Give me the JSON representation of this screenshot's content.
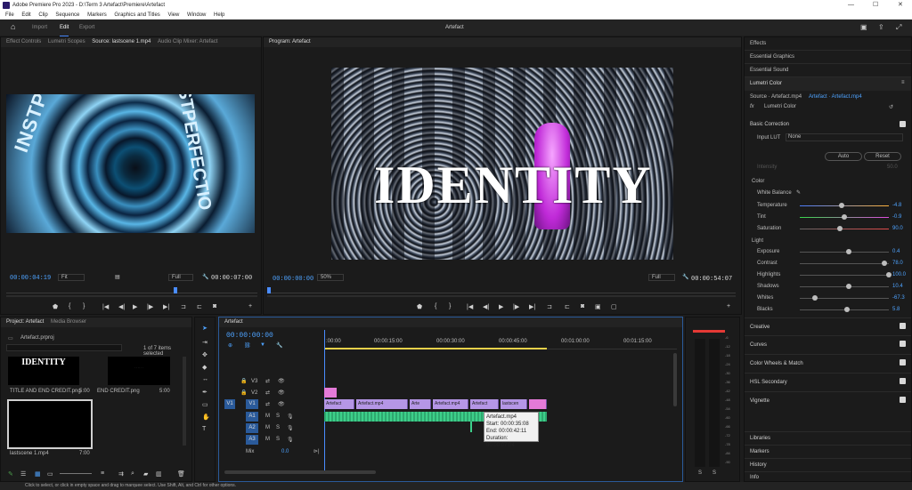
{
  "window": {
    "title": "Adobe Premiere Pro 2023 - D:\\Term 3 Artefact\\Premiere\\Artefact",
    "minimize": "—",
    "maximize": "☐",
    "close": "✕"
  },
  "menu": [
    "File",
    "Edit",
    "Clip",
    "Sequence",
    "Markers",
    "Graphics and Titles",
    "View",
    "Window",
    "Help"
  ],
  "appbar": {
    "tabs": [
      "Import",
      "Edit",
      "Export"
    ],
    "active": "Edit",
    "project": "Artefact"
  },
  "source": {
    "tabs": [
      "Effect Controls",
      "Lumetri Scopes",
      "Source: lastscene 1.mp4",
      "Audio Clip Mixer: Artefact"
    ],
    "timecode": "00:00:04:19",
    "fit": "Fit",
    "quality": "Full",
    "duration": "00:00:07:00",
    "overlay_text": "INSTPERFECTIO"
  },
  "program": {
    "tab": "Program: Artefact",
    "timecode": "00:00:00:00",
    "zoom": "50%",
    "quality": "Full",
    "duration": "00:00:54:07",
    "title_text": "IDENTITY"
  },
  "project": {
    "tabs": [
      "Project: Artefact",
      "Media Browser"
    ],
    "file": "Artefact.prproj",
    "selection": "1 of 7 items selected",
    "items": [
      {
        "name": "TITLE AND END CREDIT.png",
        "dur": "5:00"
      },
      {
        "name": "END CREDIT.png",
        "dur": "5:00"
      },
      {
        "name": "lastscene 1.mp4",
        "dur": "7:00"
      }
    ]
  },
  "timeline": {
    "tab": "Artefact",
    "timecode": "00:00:00:00",
    "ruler": [
      ":00:00",
      "00:00:15:00",
      "00:00:30:00",
      "00:00:45:00",
      "00:01:00:00",
      "00:01:15:00"
    ],
    "tracks": [
      "V3",
      "V2",
      "V1",
      "A1",
      "A2",
      "A3"
    ],
    "mix_label": "Mix",
    "mix_value": "0.0",
    "clips": [
      "Artefact",
      "Artefact.mp4",
      "Arte",
      "Artefact.mp4",
      "Artefact",
      "lastscen"
    ],
    "tooltip": [
      "Artefact.mp4",
      "Start: 00:00:35:08",
      "End: 00:00:42:11",
      "Duration: 00:00:07:04"
    ]
  },
  "meters": {
    "scale": [
      "-6",
      "-12",
      "-18",
      "-24",
      "-30",
      "-36",
      "-42",
      "-48",
      "-54",
      "-60",
      "-66",
      "-72",
      "-78",
      "-84",
      "-90",
      "dB"
    ],
    "solo": [
      "S",
      "S"
    ]
  },
  "right": {
    "panels": [
      "Effects",
      "Essential Graphics",
      "Essential Sound"
    ],
    "lumetri": "Lumetri Color",
    "source_line": "Source · Artefact.mp4",
    "target": "Artefact · Artefact.mp4",
    "fx": "Lumetri Color",
    "basic": "Basic Correction",
    "input_lut": "Input LUT",
    "lut_value": "None",
    "auto": "Auto",
    "reset": "Reset",
    "intensity": "Intensity",
    "intensity_val": "50.0",
    "color": "Color",
    "white_balance": "White Balance",
    "params": [
      {
        "label": "Temperature",
        "value": "-4.8",
        "pos": 0.47
      },
      {
        "label": "Tint",
        "value": "-0.9",
        "pos": 0.5
      },
      {
        "label": "Saturation",
        "value": "90.0",
        "pos": 0.45
      },
      {
        "label": "Exposure",
        "value": "0.4",
        "pos": 0.55
      },
      {
        "label": "Contrast",
        "value": "78.0",
        "pos": 0.95
      },
      {
        "label": "Highlights",
        "value": "100.0",
        "pos": 1.0
      },
      {
        "label": "Shadows",
        "value": "10.4",
        "pos": 0.55
      },
      {
        "label": "Whites",
        "value": "-67.3",
        "pos": 0.17
      },
      {
        "label": "Blacks",
        "value": "5.8",
        "pos": 0.53
      }
    ],
    "light": "Light",
    "sections": [
      "Creative",
      "Curves",
      "Color Wheels & Match",
      "HSL Secondary",
      "Vignette"
    ],
    "bottom": [
      "Libraries",
      "Markers",
      "History",
      "Info"
    ]
  },
  "status": "Click to select, or click in empty space and drag to marquee select. Use Shift, Alt, and Ctrl for other options."
}
